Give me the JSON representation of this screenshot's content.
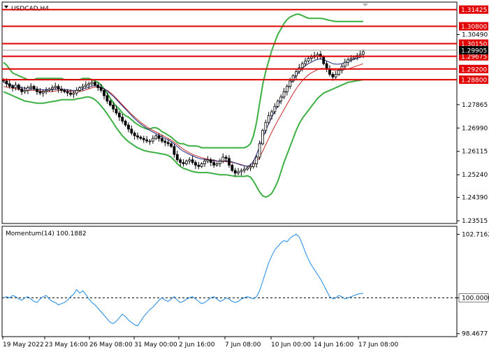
{
  "colors": {
    "background": "#ffffff",
    "frame": "#000000",
    "candle": "#000000",
    "bollinger": "#3cb043",
    "ma_fast": "#1a237e",
    "ma_slow": "#c62828",
    "level_line": "#e00000",
    "level_badge": "#e00000",
    "momentum": "#1e88e5",
    "reference": "#000000"
  },
  "header": {
    "symbol_label": "USDCAD,H4"
  },
  "chart_data": [
    {
      "type": "line",
      "title": "USDCAD,H4",
      "y_axis": {
        "ticks": [
          1.3049,
          1.29905,
          1.27865,
          1.2699,
          1.26115,
          1.2524,
          1.2439,
          1.23515
        ],
        "tick_labels": [
          "1.30490",
          "1.29905",
          "1.27865",
          "1.26990",
          "1.26115",
          "1.25240",
          "1.24390",
          "1.23515"
        ],
        "ylim": [
          1.2344,
          1.3168
        ]
      },
      "x_axis": {
        "tick_labels": [
          "19 May 2022",
          "23 May 16:00",
          "26 May 08:00",
          "31 May 00:00",
          "2 Jun 16:00",
          "7 Jun 08:00",
          "10 Jun 00:00",
          "14 Jun 16:00",
          "17 Jun 08:00"
        ]
      },
      "levels": [
        {
          "value": 1.31425,
          "label": "1.31425"
        },
        {
          "value": 1.308,
          "label": "1.30800"
        },
        {
          "value": 1.3015,
          "label": "1.30150"
        },
        {
          "value": 1.29675,
          "label": "1.29675"
        },
        {
          "value": 1.292,
          "label": "1.29200"
        },
        {
          "value": 1.288,
          "label": "1.28800"
        }
      ],
      "price_badge": {
        "value": 1.29905,
        "label": "1.29905"
      },
      "price_close": [
        1.2875,
        1.2865,
        1.2855,
        1.285,
        1.286,
        1.2845,
        1.2835,
        1.284,
        1.285,
        1.2855,
        1.2845,
        1.2835,
        1.283,
        1.2835,
        1.284,
        1.2845,
        1.285,
        1.2855,
        1.2845,
        1.284,
        1.2835,
        1.283,
        1.2825,
        1.283,
        1.284,
        1.285,
        1.2855,
        1.286,
        1.2865,
        1.287,
        1.286,
        1.285,
        1.284,
        1.282,
        1.28,
        1.2785,
        1.277,
        1.2755,
        1.274,
        1.2725,
        1.271,
        1.2695,
        1.268,
        1.267,
        1.2665,
        1.266,
        1.2655,
        1.265,
        1.265,
        1.266,
        1.267,
        1.266,
        1.265,
        1.2645,
        1.264,
        1.263,
        1.26,
        1.258,
        1.257,
        1.2565,
        1.2575,
        1.258,
        1.257,
        1.256,
        1.2555,
        1.2565,
        1.2575,
        1.258,
        1.257,
        1.256,
        1.2565,
        1.2575,
        1.259,
        1.2585,
        1.256,
        1.254,
        1.253,
        1.2535,
        1.254,
        1.2545,
        1.255,
        1.2555,
        1.2565,
        1.259,
        1.264,
        1.269,
        1.272,
        1.2745,
        1.276,
        1.278,
        1.28,
        1.2815,
        1.2835,
        1.2855,
        1.2875,
        1.2895,
        1.291,
        1.2925,
        1.294,
        1.295,
        1.296,
        1.2965,
        1.297,
        1.2975,
        1.2965,
        1.294,
        1.292,
        1.29,
        1.289,
        1.29,
        1.2915,
        1.293,
        1.2945,
        1.2955,
        1.296,
        1.2965,
        1.297,
        1.2975,
        1.2985
      ],
      "bollinger": {
        "upper": [
          1.2945,
          1.2935,
          1.292,
          1.2905,
          1.29,
          1.2895,
          1.289,
          1.2885,
          1.288,
          1.288,
          1.288,
          1.2885,
          1.2885,
          1.2885,
          1.2885,
          1.2885,
          1.2885,
          1.2885,
          1.2885,
          1.2885,
          1.288,
          1.288,
          1.288,
          1.288,
          1.288,
          1.288,
          1.2885,
          1.2885,
          1.2885,
          1.288,
          1.2875,
          1.287,
          1.286,
          1.2845,
          1.283,
          1.281,
          1.2795,
          1.278,
          1.277,
          1.2755,
          1.2745,
          1.274,
          1.273,
          1.272,
          1.2712,
          1.2705,
          1.27,
          1.2695,
          1.2695,
          1.27,
          1.27,
          1.2695,
          1.2685,
          1.268,
          1.2672,
          1.2665,
          1.2655,
          1.2645,
          1.264,
          1.264,
          1.2635,
          1.2632,
          1.2632,
          1.2632,
          1.263,
          1.2625,
          1.2625,
          1.2625,
          1.2625,
          1.2625,
          1.2625,
          1.2625,
          1.2625,
          1.2625,
          1.2625,
          1.2625,
          1.2625,
          1.2625,
          1.2625,
          1.2625,
          1.263,
          1.264,
          1.267,
          1.272,
          1.279,
          1.286,
          1.291,
          1.295,
          1.299,
          1.302,
          1.305,
          1.307,
          1.309,
          1.3105,
          1.3115,
          1.312,
          1.3125,
          1.3125,
          1.312,
          1.3115,
          1.311,
          1.311,
          1.311,
          1.311,
          1.311,
          1.3108,
          1.3105,
          1.3102,
          1.31,
          1.3098,
          1.3098,
          1.3098,
          1.3098,
          1.3098,
          1.3098,
          1.3098,
          1.3098,
          1.3098,
          1.3098
        ],
        "lower": [
          1.2835,
          1.283,
          1.2825,
          1.282,
          1.2815,
          1.281,
          1.2805,
          1.28,
          1.2798,
          1.2796,
          1.2794,
          1.2792,
          1.2792,
          1.2792,
          1.2794,
          1.2796,
          1.2798,
          1.28,
          1.2802,
          1.2805,
          1.2805,
          1.2805,
          1.2805,
          1.2805,
          1.2808,
          1.281,
          1.2812,
          1.2815,
          1.2815,
          1.2812,
          1.2805,
          1.2795,
          1.2782,
          1.2768,
          1.2752,
          1.2735,
          1.2718,
          1.27,
          1.2685,
          1.267,
          1.2658,
          1.2648,
          1.264,
          1.2632,
          1.2625,
          1.262,
          1.2615,
          1.2612,
          1.261,
          1.2608,
          1.2606,
          1.2604,
          1.2602,
          1.26,
          1.2596,
          1.259,
          1.2578,
          1.2565,
          1.2555,
          1.2548,
          1.2544,
          1.254,
          1.2536,
          1.2534,
          1.2532,
          1.2532,
          1.2532,
          1.2532,
          1.253,
          1.2528,
          1.2526,
          1.2524,
          1.2524,
          1.2524,
          1.2522,
          1.252,
          1.2518,
          1.2518,
          1.2518,
          1.2518,
          1.252,
          1.2515,
          1.25,
          1.248,
          1.246,
          1.2445,
          1.244,
          1.2445,
          1.2455,
          1.2475,
          1.25,
          1.2535,
          1.257,
          1.26,
          1.263,
          1.266,
          1.269,
          1.2715,
          1.2735,
          1.275,
          1.2765,
          1.278,
          1.2795,
          1.281,
          1.282,
          1.283,
          1.2835,
          1.284,
          1.2845,
          1.285,
          1.2855,
          1.286,
          1.2865,
          1.287,
          1.2872,
          1.2874,
          1.2876,
          1.2878,
          1.288
        ]
      },
      "ma_fast": [
        1.287,
        1.2865,
        1.286,
        1.2858,
        1.2856,
        1.2854,
        1.285,
        1.2848,
        1.2846,
        1.2846,
        1.2845,
        1.2844,
        1.2843,
        1.2842,
        1.2842,
        1.2842,
        1.2843,
        1.2844,
        1.2845,
        1.2845,
        1.2844,
        1.2842,
        1.284,
        1.284,
        1.284,
        1.2842,
        1.2845,
        1.2848,
        1.2852,
        1.2856,
        1.2858,
        1.2856,
        1.2852,
        1.2846,
        1.2838,
        1.2828,
        1.2818,
        1.2806,
        1.2794,
        1.2782,
        1.277,
        1.2758,
        1.2746,
        1.2734,
        1.2724,
        1.2714,
        1.2706,
        1.2698,
        1.269,
        1.2684,
        1.2678,
        1.2672,
        1.2666,
        1.266,
        1.2655,
        1.2648,
        1.264,
        1.263,
        1.262,
        1.2612,
        1.2606,
        1.26,
        1.2595,
        1.259,
        1.2586,
        1.2583,
        1.2581,
        1.258,
        1.2578,
        1.2576,
        1.2575,
        1.2575,
        1.2576,
        1.2576,
        1.2575,
        1.2572,
        1.2568,
        1.2564,
        1.256,
        1.2558,
        1.2556,
        1.256,
        1.2575,
        1.26,
        1.263,
        1.266,
        1.269,
        1.2715,
        1.274,
        1.2762,
        1.2784,
        1.2804,
        1.2824,
        1.2844,
        1.2862,
        1.288,
        1.2895,
        1.291,
        1.2922,
        1.2932,
        1.294,
        1.2946,
        1.2952,
        1.2956,
        1.2958,
        1.2955,
        1.295,
        1.2945,
        1.294,
        1.2938,
        1.2938,
        1.294,
        1.2944,
        1.2948,
        1.2952,
        1.2956,
        1.296,
        1.2964,
        1.2968
      ],
      "ma_slow": [
        1.2855,
        1.2852,
        1.285,
        1.2848,
        1.2846,
        1.2844,
        1.2842,
        1.284,
        1.284,
        1.284,
        1.284,
        1.284,
        1.2838,
        1.2836,
        1.2835,
        1.2835,
        1.2836,
        1.2838,
        1.284,
        1.284,
        1.284,
        1.2838,
        1.2836,
        1.2835,
        1.2835,
        1.2836,
        1.2838,
        1.2842,
        1.2846,
        1.285,
        1.2852,
        1.2852,
        1.285,
        1.2846,
        1.284,
        1.2832,
        1.2822,
        1.281,
        1.2798,
        1.2786,
        1.2774,
        1.2762,
        1.275,
        1.274,
        1.273,
        1.272,
        1.2712,
        1.2704,
        1.2696,
        1.269,
        1.2684,
        1.2678,
        1.2672,
        1.2666,
        1.266,
        1.2654,
        1.2646,
        1.2638,
        1.2628,
        1.262,
        1.2612,
        1.2606,
        1.26,
        1.2596,
        1.2592,
        1.2588,
        1.2585,
        1.2582,
        1.258,
        1.2578,
        1.2576,
        1.2575,
        1.2574,
        1.2573,
        1.2572,
        1.257,
        1.2568,
        1.2565,
        1.2562,
        1.2558,
        1.2555,
        1.2555,
        1.256,
        1.2572,
        1.259,
        1.2612,
        1.2636,
        1.266,
        1.2684,
        1.2706,
        1.2728,
        1.2748,
        1.2768,
        1.2788,
        1.2808,
        1.2828,
        1.2846,
        1.2862,
        1.2876,
        1.2888,
        1.2898,
        1.2906,
        1.2912,
        1.2918,
        1.2922,
        1.2922,
        1.292,
        1.2918,
        1.2916,
        1.2915,
        1.2915,
        1.2916,
        1.2918,
        1.292,
        1.2924,
        1.2928,
        1.2932,
        1.2936,
        1.294
      ]
    },
    {
      "type": "line",
      "title": "Momentum(14) 100.1882",
      "name": "Momentum(14)",
      "current_value": 100.1882,
      "y_axis": {
        "ticks": [
          102.7162,
          100.0,
          98.4677
        ],
        "tick_labels": [
          "102.7162",
          "100.0000",
          "98.4677"
        ],
        "ylim": [
          98.4,
          103.0
        ]
      },
      "reference_value": 100.0,
      "reference_label": "100.0000",
      "values": [
        100.0,
        100.05,
        100.0,
        100.1,
        100.05,
        99.95,
        99.9,
        100.0,
        100.05,
        99.95,
        99.85,
        99.8,
        99.95,
        100.05,
        100.1,
        99.95,
        99.85,
        99.8,
        99.7,
        99.75,
        99.8,
        99.9,
        100.05,
        100.15,
        100.35,
        100.2,
        100.3,
        100.15,
        99.95,
        99.8,
        99.7,
        99.55,
        99.4,
        99.25,
        99.1,
        98.95,
        98.9,
        99.0,
        99.15,
        99.3,
        99.2,
        99.05,
        98.95,
        98.85,
        98.8,
        99.0,
        99.2,
        99.35,
        99.5,
        99.6,
        99.75,
        99.9,
        100.0,
        99.9,
        99.85,
        99.95,
        100.05,
        99.9,
        99.8,
        99.85,
        99.95,
        100.0,
        100.05,
        99.95,
        99.85,
        99.75,
        99.8,
        99.9,
        100.0,
        100.05,
        99.95,
        99.85,
        99.9,
        100.0,
        99.95,
        99.85,
        99.8,
        99.85,
        99.95,
        100.0,
        100.05,
        100.0,
        99.95,
        100.05,
        100.3,
        100.7,
        101.1,
        101.5,
        101.8,
        102.05,
        102.2,
        102.35,
        102.45,
        102.4,
        102.55,
        102.65,
        102.72,
        102.6,
        102.3,
        101.95,
        101.65,
        101.4,
        101.2,
        101.0,
        100.8,
        100.55,
        100.3,
        100.05,
        99.95,
        100.0,
        100.1,
        100.05,
        99.95,
        100.0,
        100.05,
        100.1,
        100.15,
        100.18,
        100.19
      ]
    }
  ]
}
